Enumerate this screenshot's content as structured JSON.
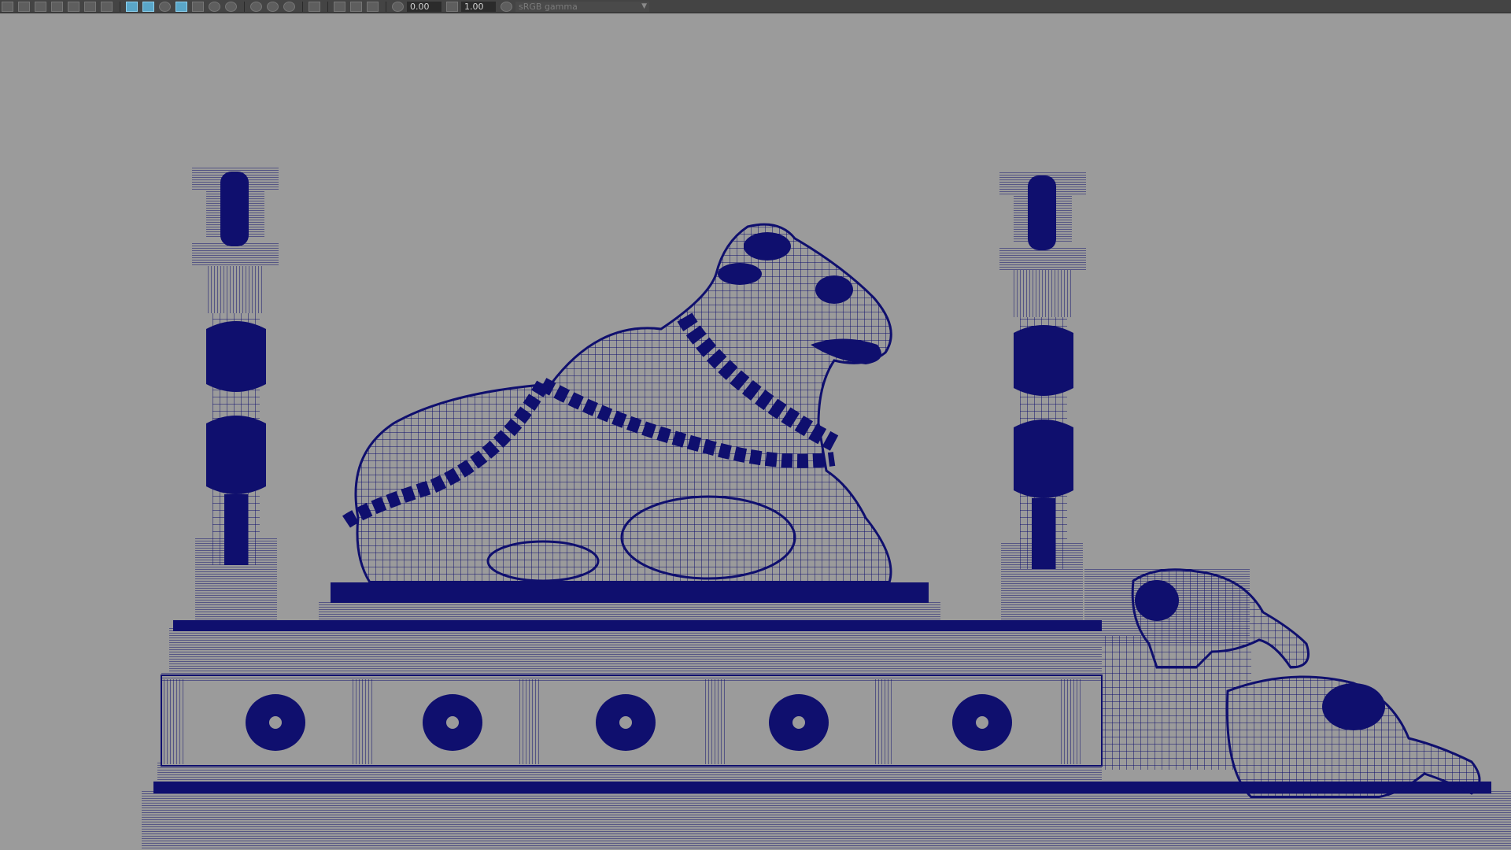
{
  "toolbar": {
    "exposure_value": "0.00",
    "gamma_value": "1.00",
    "color_space": "sRGB gamma",
    "icons": [
      "select-camera-icon",
      "lock-camera-icon",
      "camera-attributes-icon",
      "image-plane-icon",
      "grid-icon",
      "film-gate-icon",
      "resolution-gate-icon",
      "wireframe-icon",
      "smooth-shade-icon",
      "wireframe-on-shaded-icon",
      "xray-icon",
      "textured-icon",
      "lighting-icon",
      "shadows-icon",
      "ambient-occlusion-icon",
      "motion-blur-icon",
      "anti-aliasing-icon",
      "isolate-select-icon",
      "xray-active-icon",
      "xray-joints-icon",
      "exposure-icon",
      "gamma-icon",
      "color-management-icon"
    ]
  },
  "viewport": {
    "display_mode": "wireframe",
    "background_color": "#9b9b9b",
    "wire_color": "#0f0f6e"
  },
  "scene": {
    "objects": [
      "nandi-bull-sculpture",
      "left-pillar",
      "right-pillar",
      "platform-base",
      "elephant-steps"
    ]
  }
}
